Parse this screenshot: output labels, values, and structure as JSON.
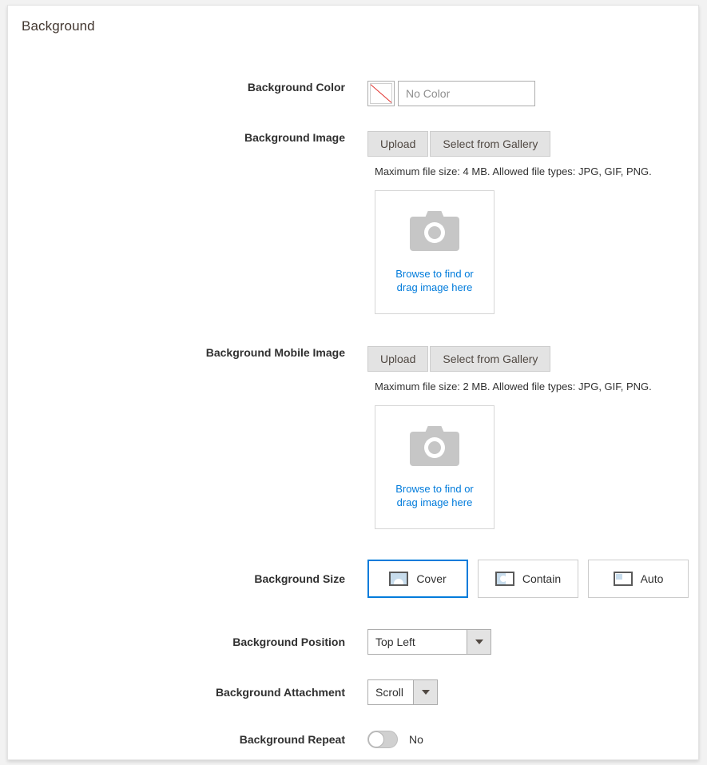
{
  "panel": {
    "title": "Background"
  },
  "color": {
    "label": "Background Color",
    "swatch_icon": "no-color-swatch-icon",
    "value": "",
    "placeholder": "No Color",
    "slash_color": "#e02b27"
  },
  "image": {
    "label": "Background Image",
    "upload_label": "Upload",
    "gallery_label": "Select from Gallery",
    "note": "Maximum file size: 4 MB. Allowed file types: JPG, GIF, PNG.",
    "dropzone": {
      "icon": "camera-icon",
      "line1": "Browse to find or",
      "line2": "drag image here",
      "link_color": "#007bdb"
    }
  },
  "mobile_image": {
    "label": "Background Mobile Image",
    "upload_label": "Upload",
    "gallery_label": "Select from Gallery",
    "note": "Maximum file size: 2 MB. Allowed file types: JPG, GIF, PNG.",
    "dropzone": {
      "icon": "camera-icon",
      "line1": "Browse to find or",
      "line2": "drag image here",
      "link_color": "#007bdb"
    }
  },
  "size": {
    "label": "Background Size",
    "selected": "Cover",
    "accent_color": "#007bdb",
    "options": [
      {
        "label": "Cover",
        "icon": "size-cover-icon",
        "selected": true
      },
      {
        "label": "Contain",
        "icon": "size-contain-icon",
        "selected": false
      },
      {
        "label": "Auto",
        "icon": "size-auto-icon",
        "selected": false
      }
    ]
  },
  "position": {
    "label": "Background Position",
    "value": "Top Left",
    "arrow_icon": "chevron-down-icon"
  },
  "attachment": {
    "label": "Background Attachment",
    "value": "Scroll",
    "arrow_icon": "chevron-down-icon"
  },
  "repeat": {
    "label": "Background Repeat",
    "state_label": "No",
    "checked": false
  }
}
